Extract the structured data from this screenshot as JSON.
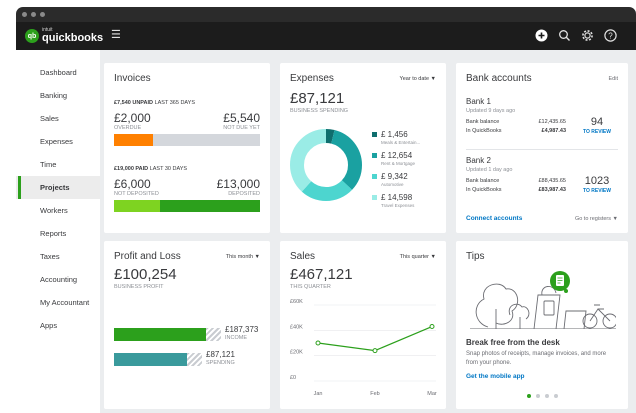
{
  "app": {
    "logo_intuit": "intuit",
    "logo_name": "quickbooks"
  },
  "topbar": {
    "icons": [
      "plus-icon",
      "search-icon",
      "gear-icon",
      "help-icon"
    ]
  },
  "sidebar": {
    "items": [
      {
        "label": "Dashboard"
      },
      {
        "label": "Banking"
      },
      {
        "label": "Sales"
      },
      {
        "label": "Expenses"
      },
      {
        "label": "Time"
      },
      {
        "label": "Projects",
        "active": true
      },
      {
        "label": "Workers"
      },
      {
        "label": "Reports"
      },
      {
        "label": "Taxes"
      },
      {
        "label": "Accounting"
      },
      {
        "label": "My Accountant"
      },
      {
        "label": "Apps"
      }
    ]
  },
  "invoices": {
    "title": "Invoices",
    "unpaid_amount": "£7,540 UNPAID",
    "unpaid_period": "LAST 365 DAYS",
    "overdue_value": "£2,000",
    "overdue_label": "OVERDUE",
    "not_due_value": "£5,540",
    "not_due_label": "NOT DUE YET",
    "overdue_fraction": 0.265,
    "paid_amount": "£19,000 PAID",
    "paid_period": "LAST 30 DAYS",
    "not_deposited_value": "£6,000",
    "not_deposited_label": "NOT DEPOSITED",
    "deposited_value": "£13,000",
    "deposited_label": "DEPOSITED",
    "not_deposited_fraction": 0.316
  },
  "expenses": {
    "title": "Expenses",
    "period": "Year to date",
    "total": "£87,121",
    "subtitle": "BUSINESS SPENDING",
    "items": [
      {
        "amount": "£ 1,456",
        "label": "Meals & Entertain...",
        "value": 1456,
        "color": "#0f6e6e"
      },
      {
        "amount": "£ 12,654",
        "label": "Rent & Mortgage",
        "value": 12654,
        "color": "#1aa1a1"
      },
      {
        "amount": "£ 9,342",
        "label": "Automotive",
        "value": 9342,
        "color": "#4dd5cf"
      },
      {
        "amount": "£ 14,598",
        "label": "Travel Expenses",
        "value": 14598,
        "color": "#9aece6"
      }
    ]
  },
  "bank": {
    "title": "Bank accounts",
    "edit": "Edit",
    "accounts": [
      {
        "name": "Bank 1",
        "updated": "Updated 9 days ago",
        "balance_label": "Bank balance",
        "balance": "£12,435.65",
        "qb_label": "In QuickBooks",
        "qb_balance": "£4,987.43",
        "review_count": "94",
        "review_label": "TO REVIEW"
      },
      {
        "name": "Bank 2",
        "updated": "Updated 1 day ago",
        "balance_label": "Bank balance",
        "balance": "£88,435.65",
        "qb_label": "In QuickBooks",
        "qb_balance": "£83,987.43",
        "review_count": "1023",
        "review_label": "TO REVIEW"
      }
    ],
    "connect": "Connect accounts",
    "goto": "Go to registers"
  },
  "profit": {
    "title": "Profit and Loss",
    "period": "This month",
    "total": "£100,254",
    "subtitle": "BUSINESS PROFIT",
    "income_value": "£187,373",
    "income_label": "INCOME",
    "spending_value": "£87,121",
    "spending_label": "SPENDING"
  },
  "sales": {
    "title": "Sales",
    "period": "This quarter",
    "total": "£467,121",
    "subtitle": "THIS QUARTER"
  },
  "chart_data": {
    "type": "line",
    "categories": [
      "Jan",
      "Feb",
      "Mar"
    ],
    "y_ticks": [
      "£60K",
      "£40K",
      "£20K",
      "£0"
    ],
    "ylim": [
      0,
      60000
    ],
    "series": [
      {
        "values": [
          30000,
          24000,
          43000
        ],
        "color": "#2ca01c"
      }
    ],
    "points_x": [
      0,
      0.5,
      1
    ]
  },
  "tips": {
    "title": "Tips",
    "heading": "Break free from the desk",
    "body": "Snap photos of receipts, manage invoices, and more from your phone.",
    "link": "Get the mobile app",
    "pages": 4,
    "active_page": 0
  },
  "colors": {
    "brand": "#2ca01c",
    "overdue": "#ff8000",
    "link": "#0077c5"
  }
}
